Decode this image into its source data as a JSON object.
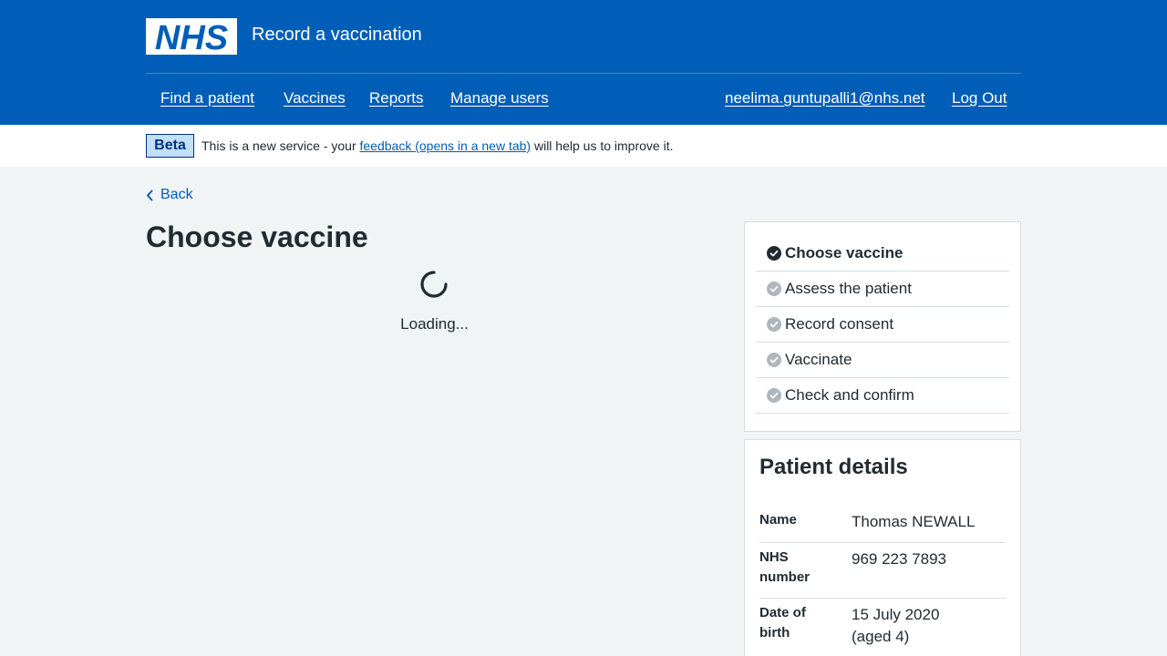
{
  "header": {
    "logo_text": "NHS",
    "service_name": "Record a vaccination",
    "nav": {
      "find_patient": "Find a patient",
      "vaccines": "Vaccines",
      "reports": "Reports",
      "manage_users": "Manage users",
      "user_email": "neelima.guntupalli1@nhs.net",
      "log_out": "Log Out"
    }
  },
  "beta_banner": {
    "tag": "Beta",
    "text_before": "This is a new service - your",
    "link_text": "feedback (opens in a new tab)",
    "text_after": "will help us to improve it."
  },
  "main": {
    "back_label": "Back",
    "title": "Choose vaccine",
    "loading_text": "Loading..."
  },
  "steps": [
    {
      "label": "Choose vaccine",
      "status": "current"
    },
    {
      "label": "Assess the patient",
      "status": "pending"
    },
    {
      "label": "Record consent",
      "status": "pending"
    },
    {
      "label": "Vaccinate",
      "status": "pending"
    },
    {
      "label": "Check and confirm",
      "status": "pending"
    }
  ],
  "patient": {
    "heading": "Patient details",
    "name_label": "Name",
    "name_value": "Thomas NEWALL",
    "nhs_label": "NHS number",
    "nhs_value": "969 223 7893",
    "dob_label": "Date of birth",
    "dob_value": "15 July 2020",
    "age_value": "(aged 4)"
  },
  "colors": {
    "nhs_blue": "#005eb8",
    "dark_text": "#212b32",
    "page_background": "#f0f4f5",
    "step_complete_icon": "#212b32",
    "step_pending_icon": "#aeb7bd"
  },
  "icons": {
    "back": "chevron-left-icon",
    "step_current": "check-circle-icon",
    "step_pending": "check-circle-grey-icon",
    "loading": "spinner-icon"
  }
}
